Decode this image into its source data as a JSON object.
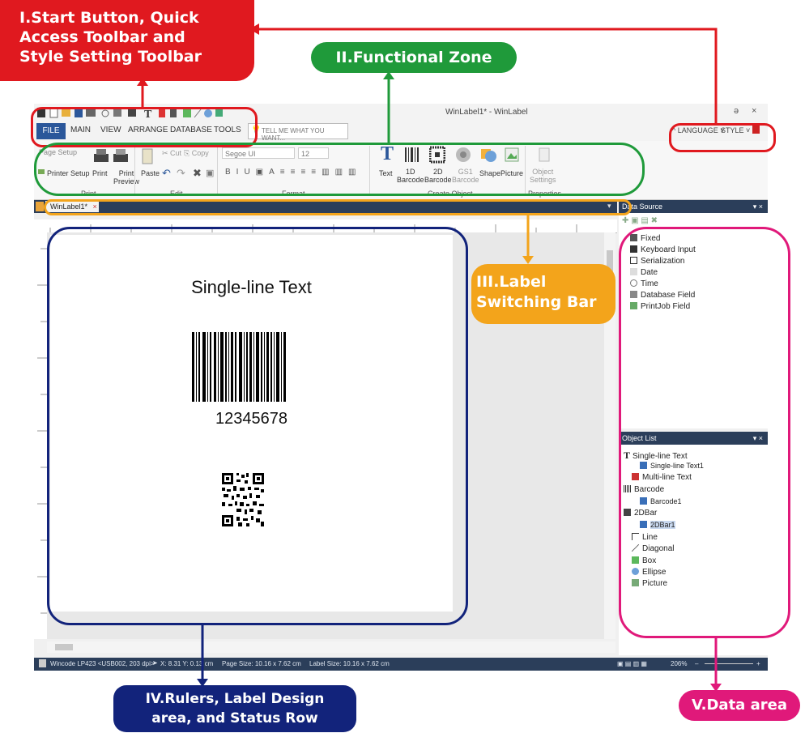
{
  "annotations": {
    "a1": [
      "I.Start Button, Quick",
      "Access Toolbar and",
      "Style Setting Toolbar"
    ],
    "a2": "II.Functional Zone",
    "a3": [
      "III.Label",
      "Switching Bar"
    ],
    "a4": [
      "IV.Rulers, Label Design",
      "area, and Status Row"
    ],
    "a5": "V.Data area"
  },
  "colors": {
    "red": "#e0191f",
    "green": "#1f9a3a",
    "orange": "#f3a41b",
    "navy": "#12237b",
    "pink": "#e0197a"
  },
  "window": {
    "title": "WinLabel1* - WinLabel"
  },
  "menu": {
    "file": "FILE",
    "items": [
      "MAIN",
      "VIEW",
      "ARRANGE",
      "DATABASE",
      "TOOLS"
    ],
    "search_placeholder": "TELL ME WHAT YOU WANT...",
    "language": "LANGUAGE",
    "style": "STYLE"
  },
  "ribbon": {
    "print": {
      "page_setup": "Page Setup",
      "printer_setup": "Printer Setup",
      "print": "Print",
      "print_preview": [
        "Print",
        "Preview"
      ],
      "group": "Print"
    },
    "edit": {
      "paste": "Paste",
      "cut": "Cut",
      "copy": "Copy",
      "group": "Edit"
    },
    "format": {
      "font": "Segoe UI",
      "size": "12",
      "group": "Format"
    },
    "create": {
      "text": "Text",
      "barcode1d": [
        "1D",
        "Barcode"
      ],
      "barcode2d": [
        "2D",
        "Barcode"
      ],
      "gs1": [
        "GS1",
        "Barcode"
      ],
      "shape": "Shape",
      "picture": "Picture",
      "group": "Create Object"
    },
    "props": {
      "settings": [
        "Object",
        "Settings"
      ],
      "group": "Properties"
    }
  },
  "tab": {
    "name": "WinLabel1*",
    "close": "×"
  },
  "label": {
    "text": "Single-line Text",
    "barcode_value": "12345678"
  },
  "status": {
    "printer": "Wincode LP423 <USB002, 203 dpi>",
    "coords": "X: 8.31  Y: 0.13 cm",
    "page_size": "Page Size: 10.16 x 7.62 cm",
    "label_size": "Label Size: 10.16 x 7.62 cm",
    "zoom": "206%"
  },
  "data_source": {
    "title": "Data Source",
    "items": [
      "Fixed",
      "Keyboard Input",
      "Serialization",
      "Date",
      "Time",
      "Database Field",
      "PrintJob Field"
    ]
  },
  "object_list": {
    "title": "Object List",
    "items": [
      "Single-line Text",
      "Single-line Text1",
      "Multi-line Text",
      "Barcode",
      "Barcode1",
      "2DBar",
      "2DBar1",
      "Line",
      "Diagonal",
      "Box",
      "Ellipse",
      "Picture"
    ]
  }
}
